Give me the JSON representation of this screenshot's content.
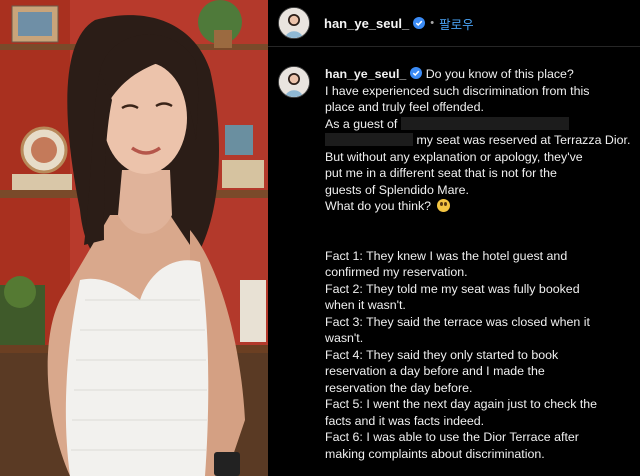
{
  "post": {
    "username": "han_ye_seul_",
    "follow_label": "팔로우",
    "separator": "•",
    "icons": {
      "verified": "verified-badge-icon",
      "emoji": "flushed-face-emoji"
    },
    "colors": {
      "follow": "#4aa3f5",
      "verified": "#3b8bf5",
      "wall": "#b83a2c"
    },
    "caption": {
      "l1": "Do you know of this place?",
      "l2": "I have experienced such discrimination from this",
      "l3": "place and truly feel offended.",
      "l4": "As a guest of",
      "l5": "my seat was reserved at Terrazza Dior.",
      "l6": "But without any explanation or apology, they've",
      "l7": "put me in a different seat that is not for the",
      "l8": "guests of Splendido Mare.",
      "l9": "What do you think?",
      "f1a": "Fact 1: They knew I was the hotel guest and",
      "f1b": "confirmed my reservation.",
      "f2a": "Fact 2: They told me my seat was fully booked",
      "f2b": "when it wasn't.",
      "f3a": "Fact 3: They said the terrace was closed when it",
      "f3b": "wasn't.",
      "f4a": "Fact 4: They said they only started to book",
      "f4b": "reservation a day before and I made the",
      "f4c": "reservation the day before.",
      "f5a": "Fact 5: I went the next day again just to check the",
      "f5b": "facts and it was facts indeed.",
      "f6a": "Fact 6: I was able to use the Dior Terrace after",
      "f6b": "making complaints about discrimination."
    }
  }
}
